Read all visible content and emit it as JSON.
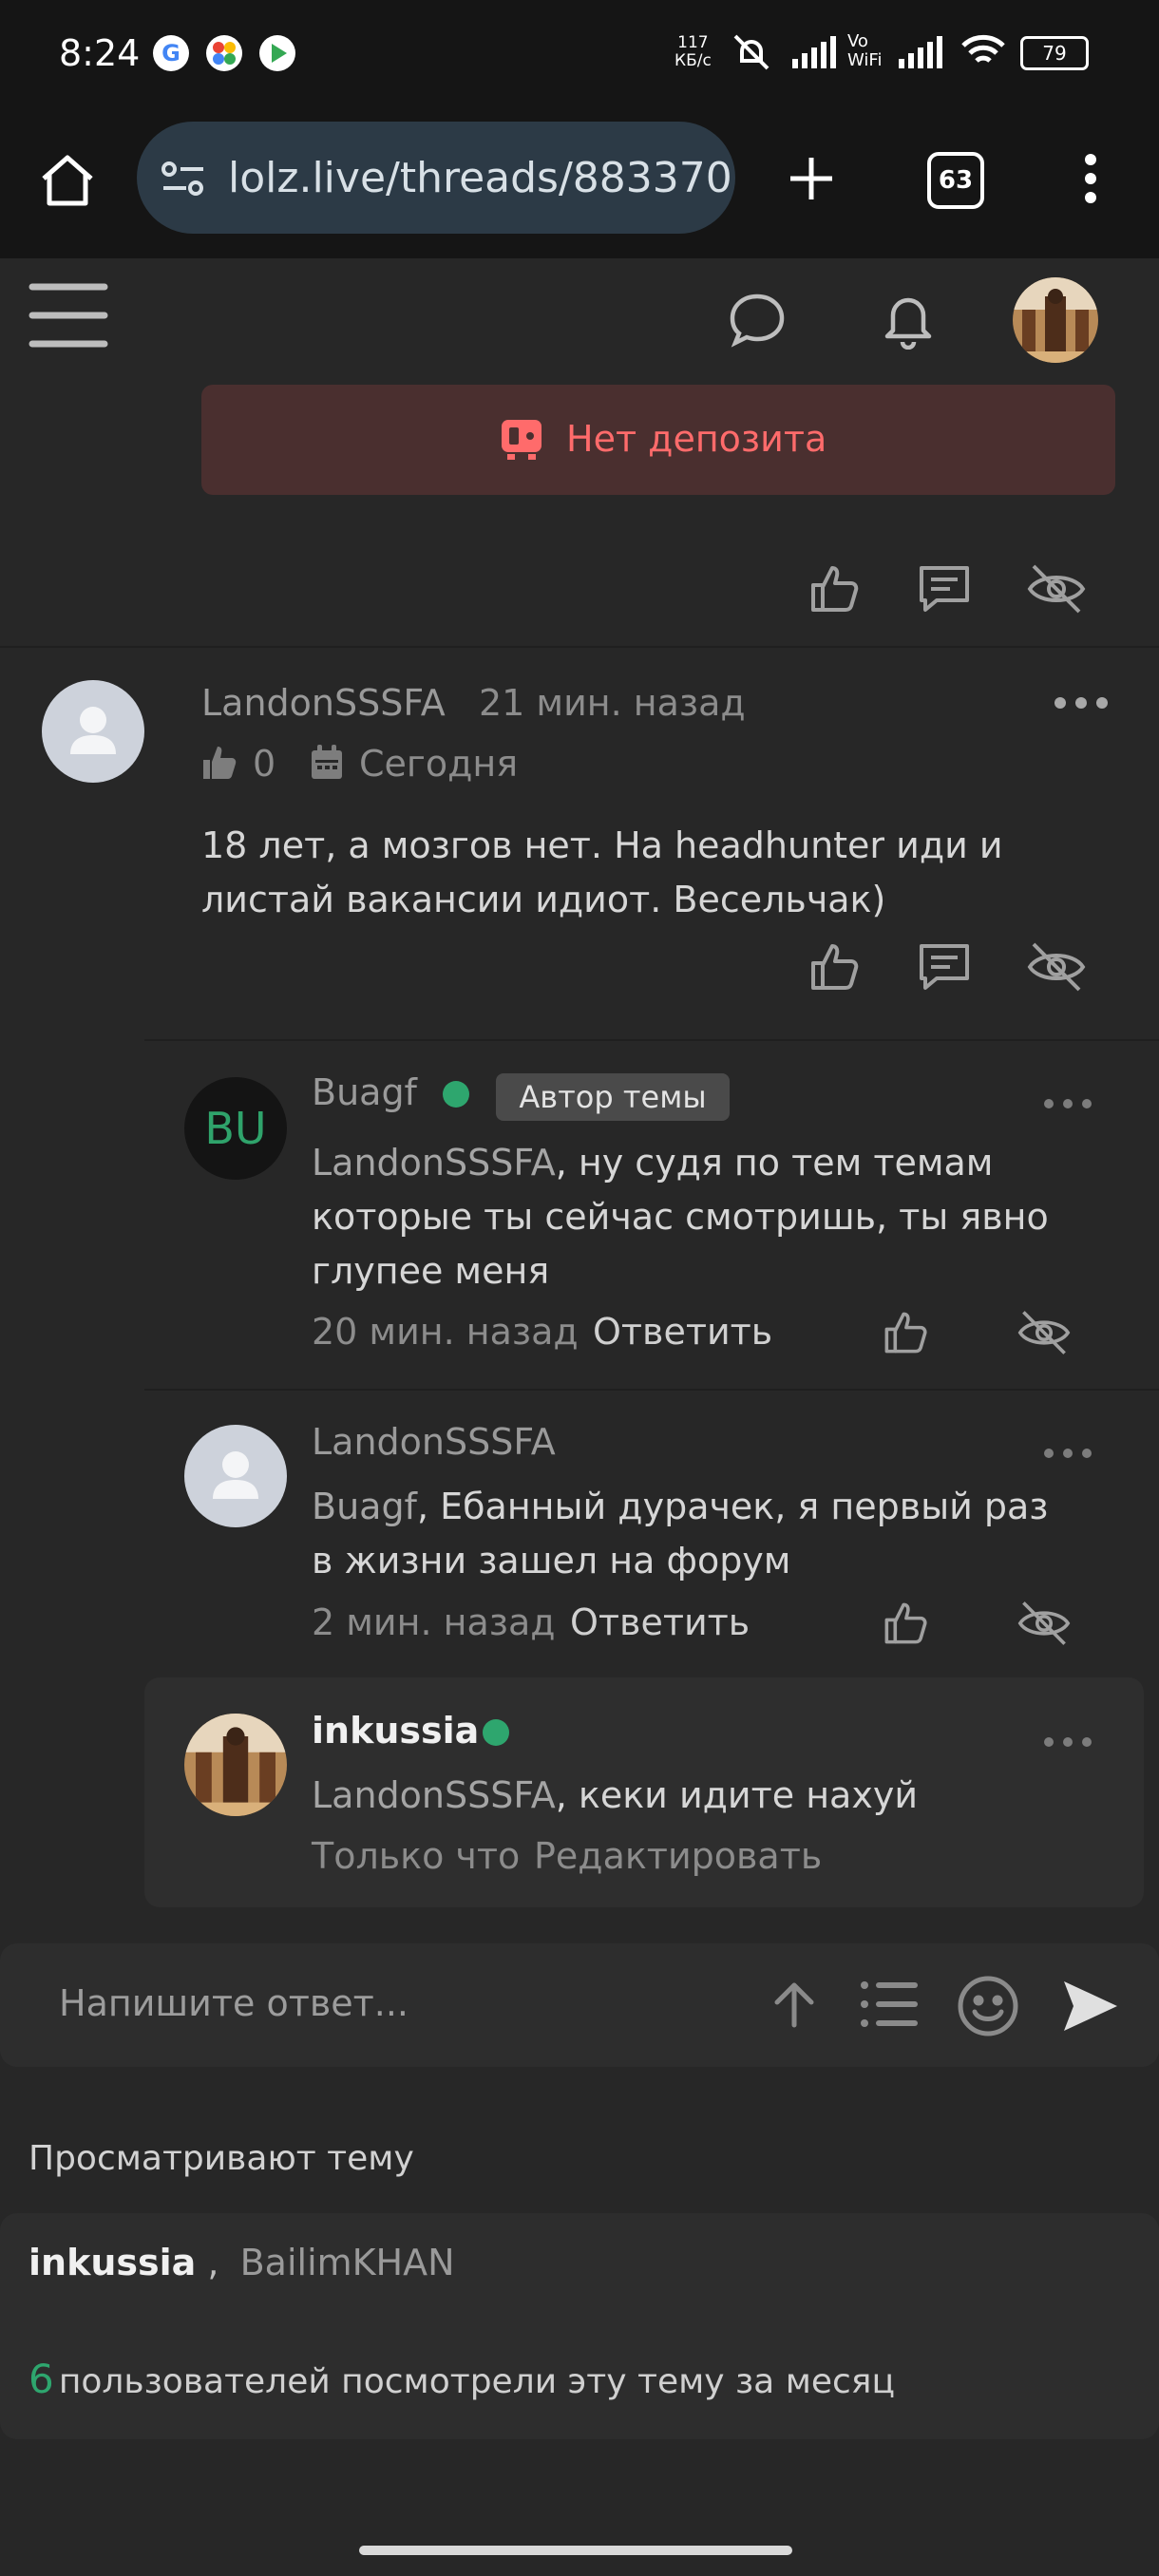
{
  "status_bar": {
    "time": "8:24",
    "net_speed": "117",
    "net_unit": "КБ/с",
    "vowifi_top": "Vo",
    "vowifi_bottom": "WiFi",
    "battery": "79"
  },
  "browser": {
    "url": "lolz.live/threads/883370",
    "tab_count": "63"
  },
  "banner": {
    "label": "Нет депозита"
  },
  "comment": {
    "author": "LandonSSSFA",
    "time": "21 мин. назад",
    "likes": "0",
    "date": "Сегодня",
    "text": "18 лет, а мозгов нет. На headhunter иди и листай вакансии идиот. Весельчак)"
  },
  "replies": [
    {
      "author": "Buagf",
      "avatar_text": "BU",
      "badge": "Автор темы",
      "mention": "LandonSSSFA",
      "text": ", ну судя по тем темам которые ты сейчас смотришь, ты явно глупее меня",
      "time": "20 мин. назад",
      "reply_label": "Ответить"
    },
    {
      "author": "LandonSSSFA",
      "mention": "Buagf",
      "text": ", Ебанный дурачек, я первый раз в жизни зашел на форум",
      "time": "2 мин. назад",
      "reply_label": "Ответить"
    },
    {
      "author": "inkussia",
      "mention": "LandonSSSFA",
      "text": ", кеки идите нахуй",
      "time": "Только что",
      "edit_label": "Редактировать"
    }
  ],
  "composer": {
    "placeholder": "Напишите ответ..."
  },
  "watching": {
    "title": "Просматривают тему",
    "user1": "inkussia",
    "separator": ",",
    "user2": "BailimKHAN",
    "count": "6",
    "count_text": "пользователей посмотрели эту тему за месяц"
  },
  "colors": {
    "background": "#272727",
    "deposit_bg": "#4a2f2f",
    "deposit_text": "#ff6b6b",
    "online": "#2ea66e",
    "count_green": "#2ea66e",
    "url_bar": "#2c3a46"
  }
}
